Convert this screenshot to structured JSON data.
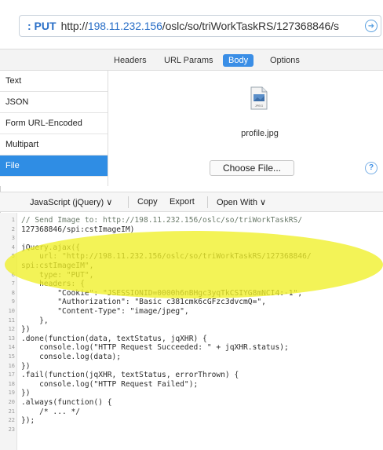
{
  "url_bar": {
    "method": ": PUT",
    "url_prefix": "http://",
    "url_host": "198.11.232.156",
    "url_path": "/oslc/so/triWorkTaskRS/127368846/s",
    "go_icon": "arrow-right-circle"
  },
  "tabs": [
    "Headers",
    "URL Params",
    "Body",
    "Options"
  ],
  "active_tab": "Body",
  "body_types": [
    "Text",
    "JSON",
    "Form URL-Encoded",
    "Multipart",
    "File"
  ],
  "active_body_type": "File",
  "file": {
    "name": "profile.jpg",
    "choose_label": "Choose File...",
    "help_label": "?",
    "icon_label": "JPEG"
  },
  "code_toolbar": {
    "language": "JavaScript (jQuery) ∨",
    "copy": "Copy",
    "export": "Export",
    "open_with": "Open With ∨"
  },
  "highlight_color": "#f0f028",
  "code_lines": [
    {
      "n": "1",
      "text": "// Send Image to: http://198.11.232.156/oslc/so/triWorkTaskRS/"
    },
    {
      "n": "2",
      "text": "127368846/spi:cstImageIM)"
    },
    {
      "n": "3",
      "text": ""
    },
    {
      "n": "4",
      "text": "jQuery.ajax({"
    },
    {
      "n": "5",
      "text": "    url: \"http://198.11.232.156/oslc/so/triWorkTaskRS/127368846/"
    },
    {
      "n": "",
      "text": "spi:cstImageIM\","
    },
    {
      "n": "6",
      "text": "    type: \"PUT\","
    },
    {
      "n": "7",
      "text": "    headers: {"
    },
    {
      "n": "8",
      "text": "        \"Cookie\": \"JSESSIONID=0000h6nBHgc3yqTkCSIYG8mNCI4:-1\","
    },
    {
      "n": "9",
      "text": "        \"Authorization\": \"Basic c381cmk6cGFzc3dvcmQ=\","
    },
    {
      "n": "10",
      "text": "        \"Content-Type\": \"image/jpeg\","
    },
    {
      "n": "11",
      "text": "    },"
    },
    {
      "n": "12",
      "text": "})"
    },
    {
      "n": "13",
      "text": ".done(function(data, textStatus, jqXHR) {"
    },
    {
      "n": "14",
      "text": "    console.log(\"HTTP Request Succeeded: \" + jqXHR.status);"
    },
    {
      "n": "15",
      "text": "    console.log(data);"
    },
    {
      "n": "16",
      "text": "})"
    },
    {
      "n": "17",
      "text": ".fail(function(jqXHR, textStatus, errorThrown) {"
    },
    {
      "n": "18",
      "text": "    console.log(\"HTTP Request Failed\");"
    },
    {
      "n": "19",
      "text": "})"
    },
    {
      "n": "20",
      "text": ".always(function() {"
    },
    {
      "n": "21",
      "text": "    /* ... */"
    },
    {
      "n": "22",
      "text": "});"
    },
    {
      "n": "23",
      "text": ""
    }
  ]
}
